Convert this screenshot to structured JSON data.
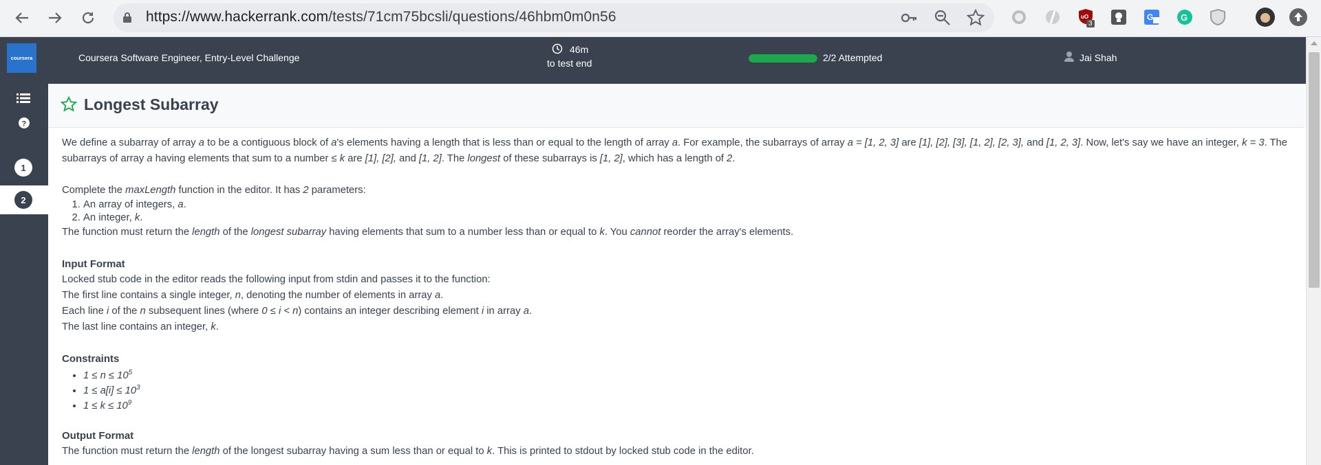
{
  "browser": {
    "url_host": "https://www.hackerrank.com",
    "url_path": "/tests/71cm75bcsli/questions/46hbm0m0n56",
    "extensions": [
      "lens-icon",
      "opera-icon",
      "ublock-icon",
      "lightbulb-icon",
      "translate-icon",
      "grammarly-icon",
      "shield-icon"
    ],
    "ublock_badge": "3"
  },
  "header": {
    "logo_text": "coursera",
    "test_title": "Coursera Software Engineer, Entry-Level Challenge",
    "timer_value": "46m",
    "timer_label": "to test end",
    "progress_fraction": 1.0,
    "progress_label": "2/2 Attempted",
    "user_name": "Jai Shah"
  },
  "sidebar": {
    "questions": [
      {
        "number": "1",
        "active": false
      },
      {
        "number": "2",
        "active": true
      }
    ]
  },
  "question": {
    "title": "Longest Subarray",
    "para1": [
      "We define a subarray of array ",
      "a",
      " to be a contiguous block of ",
      "a",
      "'s elements having a length that is less than or equal to the length of array ",
      "a",
      ". For example, the subarrays of array ",
      "a = [1, 2, 3]",
      " are ",
      "[1], [2], [3], [1, 2], [2, 3],",
      " and ",
      "[1, 2, 3]",
      ". Now, let's say we have an integer, ",
      "k = 3",
      ". The subarrays of array ",
      "a",
      " having elements that sum to a number ",
      "≤ k",
      " are ",
      "[1], [2],",
      " and ",
      "[1, 2]",
      ". The ",
      "longest",
      " of these subarrays is ",
      "[1, 2]",
      ", which has a length of ",
      "2",
      "."
    ],
    "complete_intro": [
      "Complete the ",
      "maxLength",
      " function in the editor. It has ",
      "2",
      " parameters:"
    ],
    "params": [
      [
        "An array of integers, ",
        "a",
        "."
      ],
      [
        "An integer, ",
        "k",
        "."
      ]
    ],
    "return_line": [
      "The function must return the ",
      "length",
      " of the ",
      "longest subarray",
      " having elements that sum to a number less than or equal to ",
      "k",
      ". You ",
      "cannot",
      " reorder the array's elements."
    ],
    "input_format_heading": "Input Format",
    "input_lines": [
      [
        "Locked stub code in the editor reads the following input from stdin and passes it to the function:"
      ],
      [
        "The first line contains a single integer, ",
        "n",
        ", denoting the number of elements in array ",
        "a",
        "."
      ],
      [
        "Each line ",
        "i",
        " of the ",
        "n",
        " subsequent lines (where ",
        "0 ≤ i < n",
        ") contains an integer describing element ",
        "i",
        " in array ",
        "a",
        "."
      ],
      [
        "The last line contains an integer, ",
        "k",
        "."
      ]
    ],
    "constraints_heading": "Constraints",
    "constraints": [
      [
        "1 ≤ n ≤ 10",
        "5"
      ],
      [
        "1 ≤ a[i] ≤ 10",
        "3"
      ],
      [
        "1 ≤ k ≤ 10",
        "9"
      ]
    ],
    "output_format_heading": "Output Format",
    "output_line": [
      "The function must return the ",
      "length",
      " of the longest subarray having a sum less than or equal to ",
      "k",
      ". This is printed to stdout by locked stub code in the editor."
    ]
  },
  "colors": {
    "header_bg": "#39424e",
    "progress_fill": "#1ba94c",
    "star": "#1ba94c",
    "logo_bg": "#2a73cc"
  }
}
